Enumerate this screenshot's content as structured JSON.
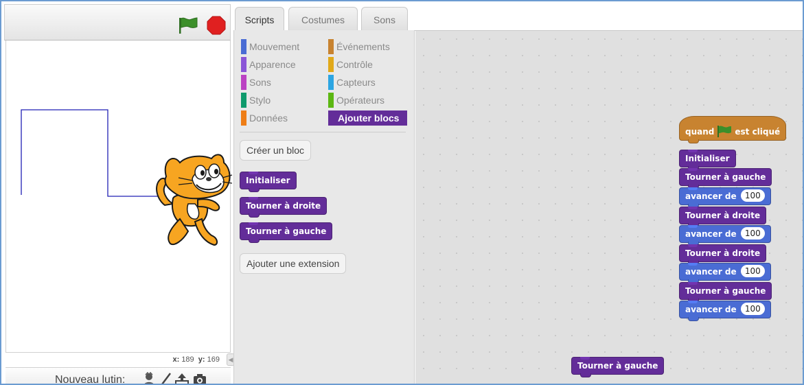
{
  "stage": {
    "coords": {
      "x_label": "x:",
      "x_value": "189",
      "y_label": "y:",
      "y_value": "169"
    },
    "new_sprite_label": "Nouveau lutin:",
    "sprite_tools": [
      "paint-from-library-icon",
      "paint-brush-icon",
      "upload-sprite-icon",
      "camera-icon"
    ]
  },
  "tabs": [
    {
      "label": "Scripts",
      "active": true
    },
    {
      "label": "Costumes",
      "active": false
    },
    {
      "label": "Sons",
      "active": false
    }
  ],
  "categories": [
    {
      "label": "Mouvement",
      "color": "#4a6cd4"
    },
    {
      "label": "Événements",
      "color": "#c88330"
    },
    {
      "label": "Apparence",
      "color": "#8a55d7"
    },
    {
      "label": "Contrôle",
      "color": "#e1a91a"
    },
    {
      "label": "Sons",
      "color": "#bb42c3"
    },
    {
      "label": "Capteurs",
      "color": "#2ca5e2"
    },
    {
      "label": "Stylo",
      "color": "#0e9a6c"
    },
    {
      "label": "Opérateurs",
      "color": "#5cb712"
    },
    {
      "label": "Données",
      "color": "#ee7d16"
    },
    {
      "label": "Ajouter blocs",
      "color": "#632d99",
      "selected": true
    }
  ],
  "palette": {
    "make_block_label": "Créer un bloc",
    "blocks": [
      "Initialiser",
      "Tourner à droite",
      "Tourner à gauche"
    ],
    "add_extension_label": "Ajouter une extension"
  },
  "script": {
    "hat": {
      "before": "quand",
      "after": "est cliqué"
    },
    "stack": [
      {
        "label": "Initialiser",
        "kind": "custom"
      },
      {
        "label": "Tourner à gauche",
        "kind": "custom"
      },
      {
        "label": "avancer de",
        "kind": "motion",
        "value": "100"
      },
      {
        "label": "Tourner à droite",
        "kind": "custom"
      },
      {
        "label": "avancer de",
        "kind": "motion",
        "value": "100"
      },
      {
        "label": "Tourner à droite",
        "kind": "custom"
      },
      {
        "label": "avancer de",
        "kind": "motion",
        "value": "100"
      },
      {
        "label": "Tourner à gauche",
        "kind": "custom"
      },
      {
        "label": "avancer de",
        "kind": "motion",
        "value": "100"
      }
    ],
    "loose_block": "Tourner à gauche"
  },
  "colors": {
    "custom_block": "#632d99",
    "motion_block": "#4a6cd4",
    "event_block": "#c88330",
    "pen_trail": "#1f1fb4",
    "stop_button": "#e02020",
    "green_flag": "#3c8f2a"
  }
}
